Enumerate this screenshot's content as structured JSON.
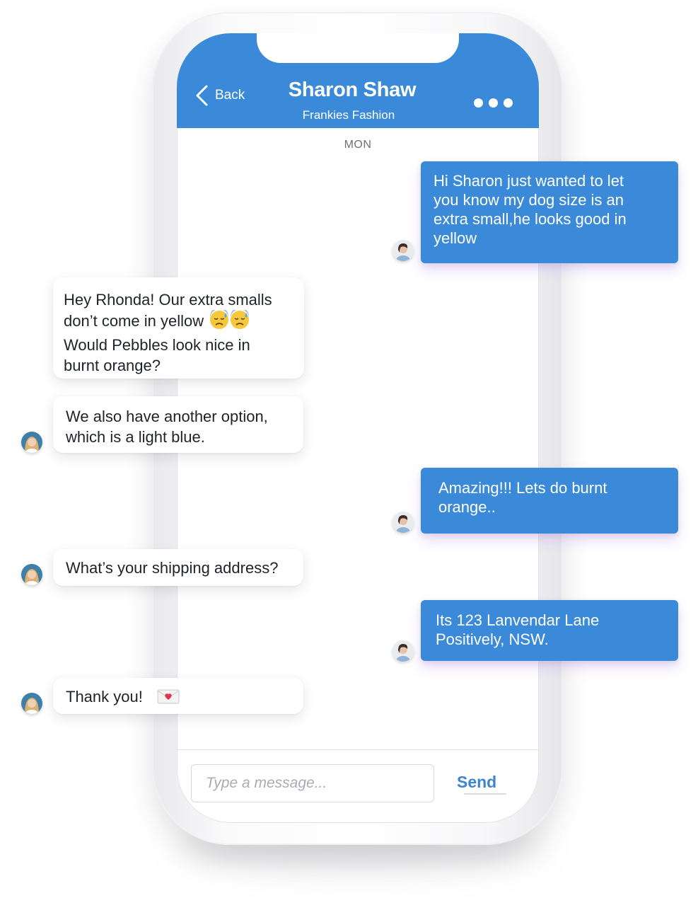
{
  "header": {
    "back_label": "Back",
    "contact_name": "Sharon Shaw",
    "contact_company": "Frankies Fashion",
    "more_icon": "more-dots-icon",
    "color": "#3b8ad9"
  },
  "conversation": {
    "day_label": "MON",
    "messages": [
      {
        "direction": "outgoing",
        "text": "Hi Sharon just wanted to let\nyou know my dog size is an\nextra small,he looks good in\nyellow"
      },
      {
        "direction": "incoming",
        "text_line1": "Hey Rhonda! Our extra smalls",
        "text_line2": "don’t come in yellow",
        "text_rest": "Would Pebbles look nice in\nburnt orange?",
        "emoji": "downcast-sweat-emoji-icon"
      },
      {
        "direction": "incoming",
        "text": "We also have another option,\nwhich is a light blue."
      },
      {
        "direction": "outgoing",
        "text": "Amazing!!! Lets do burnt\norange.."
      },
      {
        "direction": "incoming",
        "text": "What’s your shipping address?"
      },
      {
        "direction": "outgoing",
        "text": "Its 123 Lanvendar Lane\nPositively, NSW."
      },
      {
        "direction": "incoming",
        "text": "Thank you!",
        "emoji": "love-letter-emoji-icon"
      }
    ]
  },
  "composer": {
    "placeholder": "Type a message...",
    "send_label": "Send"
  },
  "colors": {
    "outgoing_bubble": "#3b8ad9",
    "incoming_bubble": "#ffffff",
    "send_text": "#3a86d5"
  }
}
